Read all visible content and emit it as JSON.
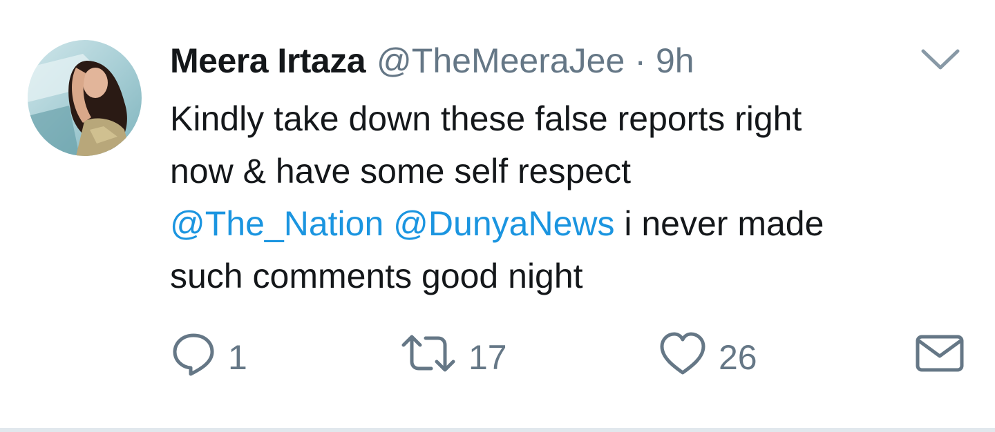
{
  "tweet": {
    "author_name": "Meera Irtaza",
    "handle": "@TheMeeraJee",
    "separator": "·",
    "time": "9h",
    "body": {
      "line1": "Kindly take down these false reports right",
      "line2": "now & have some self respect",
      "mention1": "@The_Nation",
      "mention2": "@DunyaNews",
      "line3_rest": " i never made",
      "line4": "such comments good night"
    },
    "actions": {
      "replies": "1",
      "retweets": "17",
      "likes": "26"
    }
  },
  "colors": {
    "text": "#14171a",
    "secondary": "#657786",
    "link": "#1b95e0",
    "divider": "#e1e8ed"
  },
  "icons": {
    "menu": "chevron-down-icon",
    "reply": "speech-bubble-icon",
    "retweet": "retweet-arrows-icon",
    "like": "heart-icon",
    "dm": "envelope-icon"
  }
}
